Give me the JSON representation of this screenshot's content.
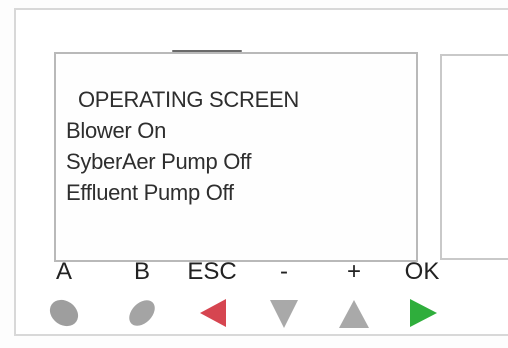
{
  "display": {
    "lines": [
      "OPERATING SCREEN",
      "Blower On",
      "SyberAer Pump Off",
      "Effluent Pump Off"
    ]
  },
  "keypad": {
    "keys": [
      {
        "label": "A",
        "icon": "oval-button-icon",
        "color": "#9e9e9e"
      },
      {
        "label": "B",
        "icon": "oval-button-icon",
        "color": "#a4a4a4"
      },
      {
        "label": "ESC",
        "icon": "arrow-left-icon",
        "color": "#d64550"
      },
      {
        "label": "-",
        "icon": "arrow-down-icon",
        "color": "#a9a9a9"
      },
      {
        "label": "+",
        "icon": "arrow-up-icon",
        "color": "#a9a9a9"
      },
      {
        "label": "OK",
        "icon": "arrow-right-icon",
        "color": "#2fae3c"
      }
    ]
  }
}
